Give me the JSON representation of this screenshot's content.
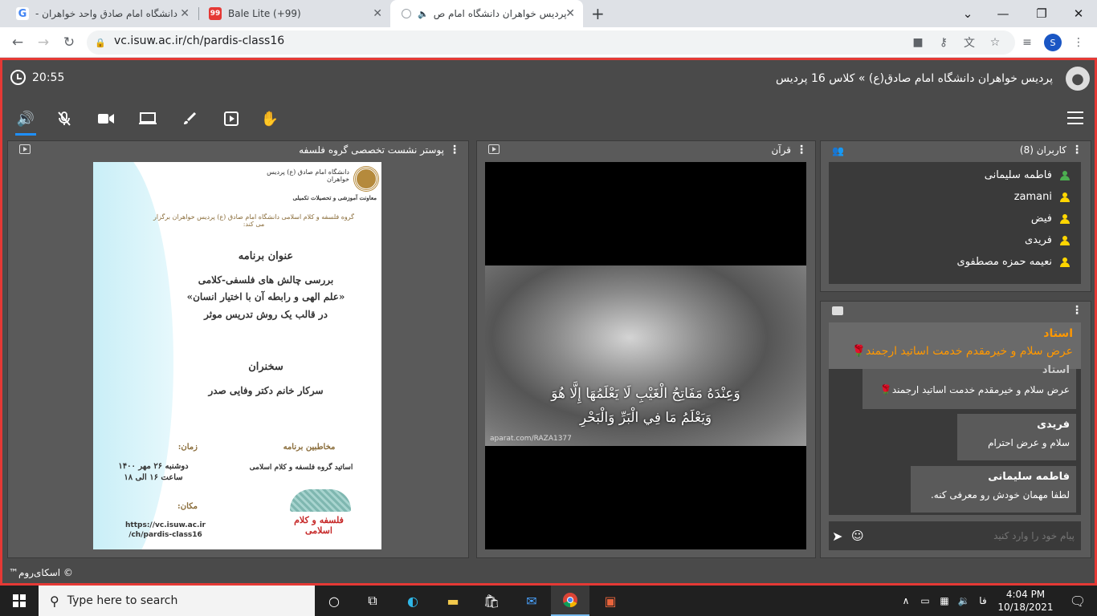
{
  "browser": {
    "tabs": [
      {
        "title": "دانشگاه امام صادق واحد خواهران -",
        "favicon": "google-icon"
      },
      {
        "title": "Bale Lite (+99)",
        "badge": "99",
        "favicon": "bale-icon"
      },
      {
        "title": "پردیس خواهران دانشگاه امام ص",
        "favicon": "site-icon"
      }
    ],
    "new_tab": "+",
    "url": "vc.isuw.ac.ir/ch/pardis-class16",
    "profile_initial": "S"
  },
  "app": {
    "time": "20:55",
    "breadcrumb": "پردیس خواهران دانشگاه امام صادق(ع) » کلاس 16 پردیس",
    "footer": "™اسکای‌روم ©",
    "accent_color": "#1e90ff",
    "border_color": "#e53935"
  },
  "panels": {
    "poster": {
      "title": "پوستر نشست تخصصی گروه فلسفه",
      "org1": "دانشگاه امام صادق (ع) پردیس خواهران",
      "org2": "معاونت آموزشی و تحصیلات تکمیلی",
      "intro": "گروه فلسفه و کلام اسلامی دانشگاه امام صادق (ع) پردیس خواهران برگزار می کند:",
      "program_title_label": "عنوان برنامه",
      "program_line1": "بررسی چالش های فلسفی-کلامی",
      "program_line2": "«علم الهی و رابطه آن با اختیار انسان»",
      "program_line3": "در قالب یک روش تدریس موثر",
      "speakers_label": "سخنران",
      "speaker": "سرکار خانم دکتر وفایی صدر",
      "audience_label": "مخاطبین برنامه",
      "audience": "اساتید گروه فلسفه و کلام اسلامی",
      "time_label": "زمان:",
      "date": "دوشنبه ۲۶ مهر ۱۴۰۰",
      "hours": "ساعت ۱۶ الی ۱۸",
      "place_label": "مکان:",
      "place_url1": "https://vc.isuw.ac.ir",
      "place_url2": "/ch/pardis-class16",
      "logo_text": "فلسفه و کلام اسلامی"
    },
    "video": {
      "title": "قرآن",
      "verse1": "وَعِنْدَهُ مَفَاتِحُ الْغَيْبِ لَا يَعْلَمُهَا إِلَّا هُوَ",
      "verse2": "وَيَعْلَمُ مَا فِي الْبَرِّ وَالْبَحْرِ",
      "watermark": "aparat.com/RAZA1377"
    },
    "users": {
      "title": "کاربران (8)",
      "list": [
        {
          "name": "فاطمه سلیمانی",
          "color": "#4caf50"
        },
        {
          "name": "zamani",
          "color": "#ffd600"
        },
        {
          "name": "فیض",
          "color": "#ffd600"
        },
        {
          "name": "فریدی",
          "color": "#ffd600"
        },
        {
          "name": "نعیمه حمزه مصطفوی",
          "color": "#ffd600"
        }
      ]
    },
    "chat": {
      "pinned": {
        "name": "استاد",
        "text": "عرض سلام و خیرمقدم خدمت اساتید ارجمند🌹"
      },
      "messages": [
        {
          "name": "استاد",
          "text": "عرض سلام و خیرمقدم خدمت اساتید ارجمند🌹"
        },
        {
          "name": "فریدی",
          "text": "سلام و عرض احترام"
        },
        {
          "name": "فاطمه سلیمانی",
          "text": "لطفا مهمان خودش رو معرفی کنه."
        }
      ],
      "placeholder": "پیام خود را وارد کنید"
    }
  },
  "taskbar": {
    "search_placeholder": "Type here to search",
    "time": "4:04 PM",
    "date": "10/18/2021",
    "lang": "فا"
  }
}
